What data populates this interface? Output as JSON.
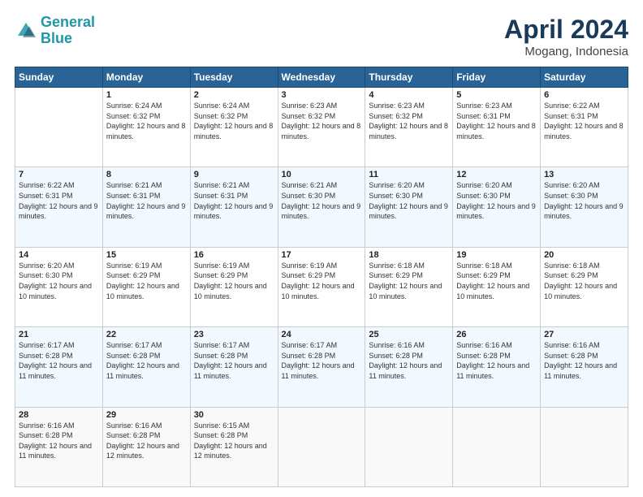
{
  "header": {
    "logo_line1": "General",
    "logo_line2": "Blue",
    "main_title": "April 2024",
    "subtitle": "Mogang, Indonesia"
  },
  "days_of_week": [
    "Sunday",
    "Monday",
    "Tuesday",
    "Wednesday",
    "Thursday",
    "Friday",
    "Saturday"
  ],
  "weeks": [
    [
      {
        "day": null
      },
      {
        "day": "1",
        "sunrise": "6:24 AM",
        "sunset": "6:32 PM",
        "daylight": "12 hours and 8 minutes."
      },
      {
        "day": "2",
        "sunrise": "6:24 AM",
        "sunset": "6:32 PM",
        "daylight": "12 hours and 8 minutes."
      },
      {
        "day": "3",
        "sunrise": "6:23 AM",
        "sunset": "6:32 PM",
        "daylight": "12 hours and 8 minutes."
      },
      {
        "day": "4",
        "sunrise": "6:23 AM",
        "sunset": "6:32 PM",
        "daylight": "12 hours and 8 minutes."
      },
      {
        "day": "5",
        "sunrise": "6:23 AM",
        "sunset": "6:31 PM",
        "daylight": "12 hours and 8 minutes."
      },
      {
        "day": "6",
        "sunrise": "6:22 AM",
        "sunset": "6:31 PM",
        "daylight": "12 hours and 8 minutes."
      }
    ],
    [
      {
        "day": "7",
        "sunrise": "6:22 AM",
        "sunset": "6:31 PM",
        "daylight": "12 hours and 9 minutes."
      },
      {
        "day": "8",
        "sunrise": "6:21 AM",
        "sunset": "6:31 PM",
        "daylight": "12 hours and 9 minutes."
      },
      {
        "day": "9",
        "sunrise": "6:21 AM",
        "sunset": "6:31 PM",
        "daylight": "12 hours and 9 minutes."
      },
      {
        "day": "10",
        "sunrise": "6:21 AM",
        "sunset": "6:30 PM",
        "daylight": "12 hours and 9 minutes."
      },
      {
        "day": "11",
        "sunrise": "6:20 AM",
        "sunset": "6:30 PM",
        "daylight": "12 hours and 9 minutes."
      },
      {
        "day": "12",
        "sunrise": "6:20 AM",
        "sunset": "6:30 PM",
        "daylight": "12 hours and 9 minutes."
      },
      {
        "day": "13",
        "sunrise": "6:20 AM",
        "sunset": "6:30 PM",
        "daylight": "12 hours and 9 minutes."
      }
    ],
    [
      {
        "day": "14",
        "sunrise": "6:20 AM",
        "sunset": "6:30 PM",
        "daylight": "12 hours and 10 minutes."
      },
      {
        "day": "15",
        "sunrise": "6:19 AM",
        "sunset": "6:29 PM",
        "daylight": "12 hours and 10 minutes."
      },
      {
        "day": "16",
        "sunrise": "6:19 AM",
        "sunset": "6:29 PM",
        "daylight": "12 hours and 10 minutes."
      },
      {
        "day": "17",
        "sunrise": "6:19 AM",
        "sunset": "6:29 PM",
        "daylight": "12 hours and 10 minutes."
      },
      {
        "day": "18",
        "sunrise": "6:18 AM",
        "sunset": "6:29 PM",
        "daylight": "12 hours and 10 minutes."
      },
      {
        "day": "19",
        "sunrise": "6:18 AM",
        "sunset": "6:29 PM",
        "daylight": "12 hours and 10 minutes."
      },
      {
        "day": "20",
        "sunrise": "6:18 AM",
        "sunset": "6:29 PM",
        "daylight": "12 hours and 10 minutes."
      }
    ],
    [
      {
        "day": "21",
        "sunrise": "6:17 AM",
        "sunset": "6:28 PM",
        "daylight": "12 hours and 11 minutes."
      },
      {
        "day": "22",
        "sunrise": "6:17 AM",
        "sunset": "6:28 PM",
        "daylight": "12 hours and 11 minutes."
      },
      {
        "day": "23",
        "sunrise": "6:17 AM",
        "sunset": "6:28 PM",
        "daylight": "12 hours and 11 minutes."
      },
      {
        "day": "24",
        "sunrise": "6:17 AM",
        "sunset": "6:28 PM",
        "daylight": "12 hours and 11 minutes."
      },
      {
        "day": "25",
        "sunrise": "6:16 AM",
        "sunset": "6:28 PM",
        "daylight": "12 hours and 11 minutes."
      },
      {
        "day": "26",
        "sunrise": "6:16 AM",
        "sunset": "6:28 PM",
        "daylight": "12 hours and 11 minutes."
      },
      {
        "day": "27",
        "sunrise": "6:16 AM",
        "sunset": "6:28 PM",
        "daylight": "12 hours and 11 minutes."
      }
    ],
    [
      {
        "day": "28",
        "sunrise": "6:16 AM",
        "sunset": "6:28 PM",
        "daylight": "12 hours and 11 minutes."
      },
      {
        "day": "29",
        "sunrise": "6:16 AM",
        "sunset": "6:28 PM",
        "daylight": "12 hours and 12 minutes."
      },
      {
        "day": "30",
        "sunrise": "6:15 AM",
        "sunset": "6:28 PM",
        "daylight": "12 hours and 12 minutes."
      },
      {
        "day": null
      },
      {
        "day": null
      },
      {
        "day": null
      },
      {
        "day": null
      }
    ]
  ]
}
